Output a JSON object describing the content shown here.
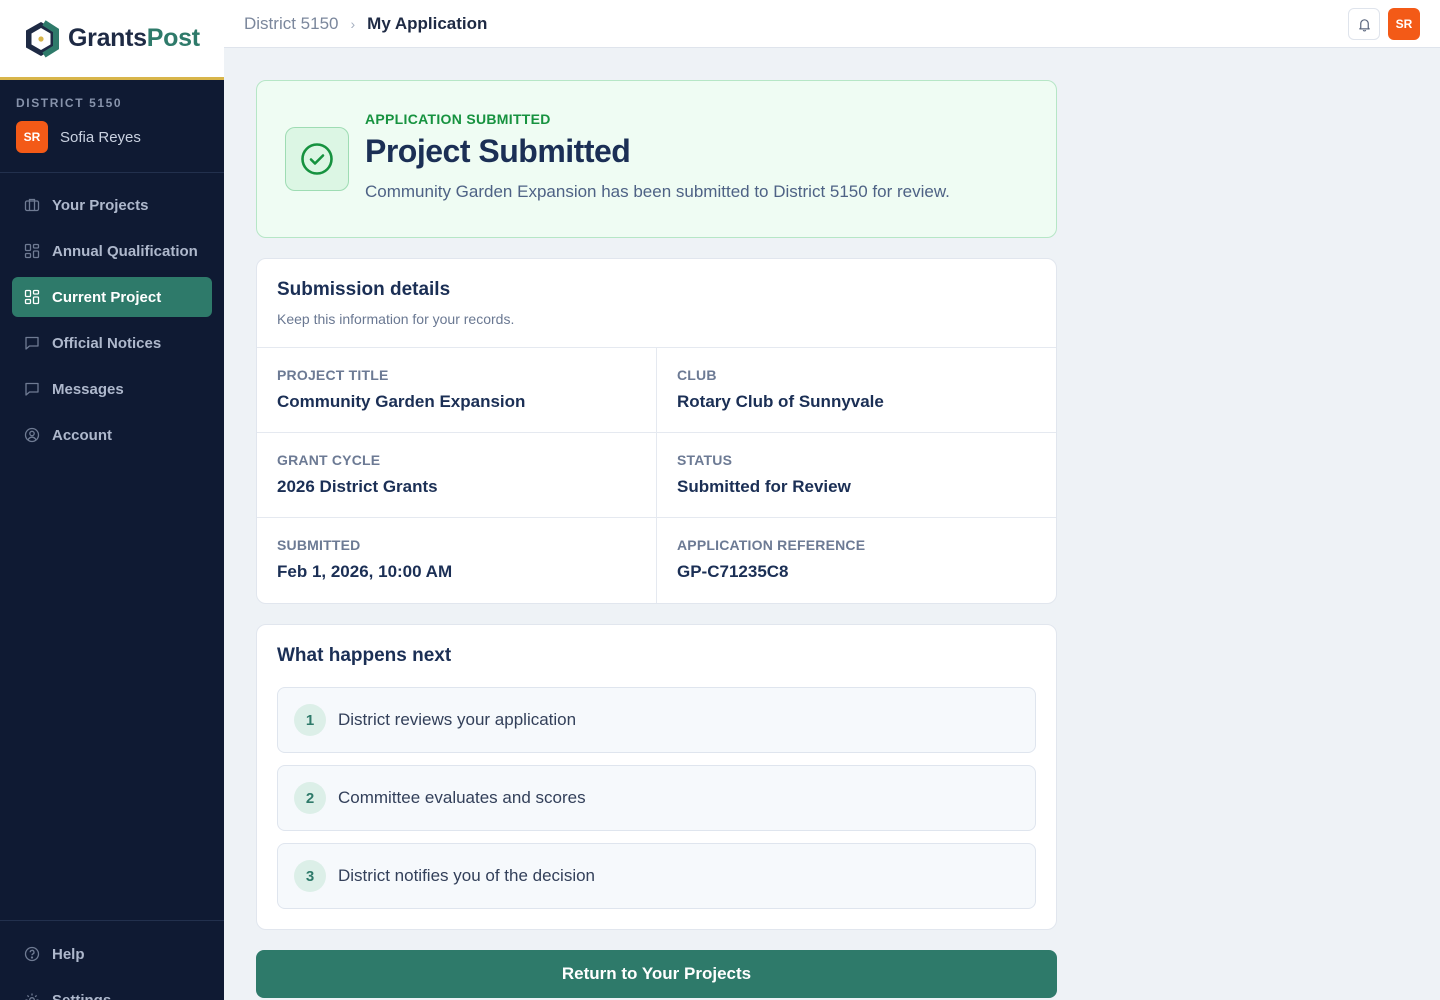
{
  "brand": {
    "name_part1": "Grants",
    "name_part2": "Post"
  },
  "sidebar": {
    "district_label": "DISTRICT 5150",
    "user": {
      "initials": "SR",
      "name": "Sofia Reyes"
    },
    "items": [
      {
        "label": "Your Projects",
        "icon": "briefcase-icon",
        "active": false
      },
      {
        "label": "Annual Qualification",
        "icon": "grid-icon",
        "active": false
      },
      {
        "label": "Current Project",
        "icon": "grid-icon",
        "active": true
      },
      {
        "label": "Official Notices",
        "icon": "message-square-icon",
        "active": false
      },
      {
        "label": "Messages",
        "icon": "message-square-icon",
        "active": false
      },
      {
        "label": "Account",
        "icon": "user-circle-icon",
        "active": false
      }
    ],
    "bottom_items": [
      {
        "label": "Help",
        "icon": "help-circle-icon"
      },
      {
        "label": "Settings",
        "icon": "gear-icon"
      }
    ]
  },
  "topbar": {
    "breadcrumb": [
      "District 5150",
      "My Application"
    ],
    "avatar_initials": "SR"
  },
  "success": {
    "eyebrow": "APPLICATION SUBMITTED",
    "title": "Project Submitted",
    "description": "Community Garden Expansion has been submitted to District 5150 for review."
  },
  "details": {
    "title": "Submission details",
    "subtitle": "Keep this information for your records.",
    "fields": [
      {
        "label": "PROJECT TITLE",
        "value": "Community Garden Expansion"
      },
      {
        "label": "CLUB",
        "value": "Rotary Club of Sunnyvale"
      },
      {
        "label": "GRANT CYCLE",
        "value": "2026 District Grants"
      },
      {
        "label": "STATUS",
        "value": "Submitted for Review"
      },
      {
        "label": "SUBMITTED",
        "value": "Feb 1, 2026, 10:00 AM"
      },
      {
        "label": "APPLICATION REFERENCE",
        "value": "GP-C71235C8"
      }
    ]
  },
  "next_steps": {
    "title": "What happens next",
    "steps": [
      {
        "num": "1",
        "text": "District reviews your application"
      },
      {
        "num": "2",
        "text": "Committee evaluates and scores"
      },
      {
        "num": "3",
        "text": "District notifies you of the decision"
      }
    ]
  },
  "actions": {
    "return_label": "Return to Your Projects"
  },
  "colors": {
    "sidebar_bg": "#0f1a33",
    "accent": "#2e7a6a",
    "avatar": "#f35a17",
    "success_green": "#16923f"
  }
}
